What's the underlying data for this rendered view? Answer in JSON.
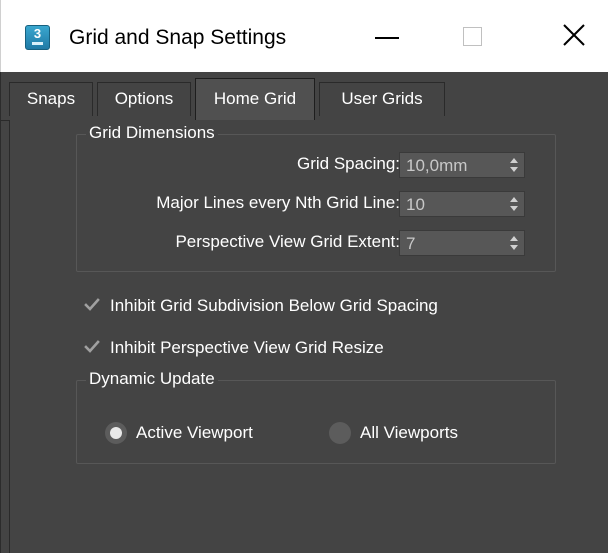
{
  "window": {
    "title": "Grid and Snap Settings",
    "icon_text": "3",
    "icon": "3dsmax-app-icon",
    "controls": {
      "minimize_icon": "minimize-icon",
      "maximize_icon": "maximize-icon",
      "close_icon": "close-icon"
    }
  },
  "tabs": [
    {
      "label": "Snaps"
    },
    {
      "label": "Options"
    },
    {
      "label": "Home Grid",
      "active": true
    },
    {
      "label": "User Grids"
    }
  ],
  "grid_dimensions": {
    "title": "Grid Dimensions",
    "fields": [
      {
        "label": "Grid Spacing:",
        "value": "10,0mm"
      },
      {
        "label": "Major Lines every Nth Grid Line:",
        "value": "10"
      },
      {
        "label": "Perspective View Grid Extent:",
        "value": "7"
      }
    ]
  },
  "options": {
    "inhibit_subdivision": {
      "label": "Inhibit Grid Subdivision Below Grid Spacing",
      "checked": true
    },
    "inhibit_resize": {
      "label": "Inhibit Perspective View Grid Resize",
      "checked": true
    }
  },
  "dynamic_update": {
    "title": "Dynamic Update",
    "options": [
      {
        "label": "Active Viewport",
        "selected": true
      },
      {
        "label": "All Viewports",
        "selected": false
      }
    ]
  },
  "colors": {
    "panel_bg": "#444444",
    "field_bg": "#575757",
    "text": "#ffffff",
    "field_text": "#c8c8c8",
    "titlebar_bg": "#ffffff"
  }
}
